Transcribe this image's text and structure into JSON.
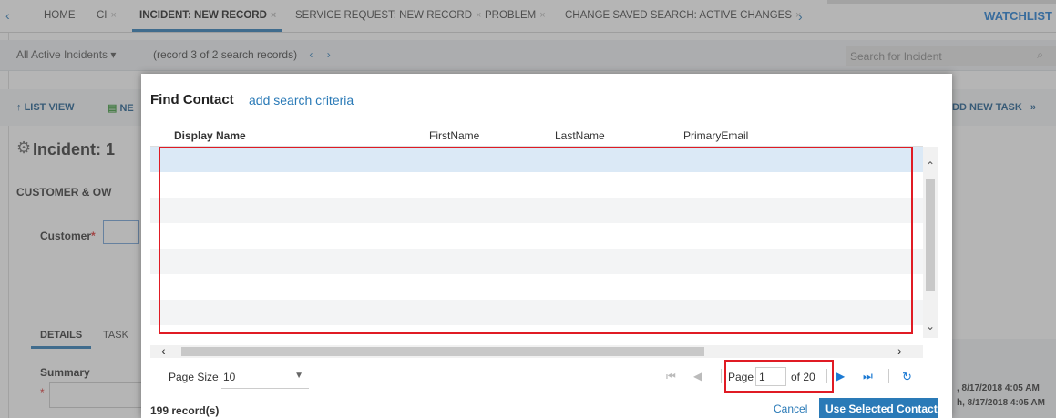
{
  "tabs": {
    "items": [
      {
        "label": "HOME",
        "closable": false
      },
      {
        "label": "CI",
        "closable": true
      },
      {
        "label": "INCIDENT: NEW RECORD",
        "closable": true,
        "active": true
      },
      {
        "label": "SERVICE REQUEST: NEW RECORD",
        "closable": true
      },
      {
        "label": "PROBLEM",
        "closable": true
      },
      {
        "label": "CHANGE SAVED SEARCH: ACTIVE CHANGES",
        "closable": true
      }
    ],
    "close_glyph": "×",
    "watchlist": "WATCHLIST"
  },
  "toolbar": {
    "saved_search": "All Active Incidents",
    "record_info": "(record 3 of 2 search records)",
    "search_placeholder": "Search for Incident"
  },
  "actions": {
    "list_view": "LIST VIEW",
    "new_partial": "NE",
    "add_task_partial": "DD NEW TASK"
  },
  "record": {
    "title_partial": "Incident: 1",
    "section_partial": "CUSTOMER & OW",
    "customer_label": "Customer",
    "required_mark": "*",
    "details_tab": "DETAILS",
    "task_tab": "TASK",
    "summary_label": "Summary",
    "timestamps": [
      ", 8/17/2018 4:05 AM",
      "h, 8/17/2018 4:05 AM"
    ]
  },
  "modal": {
    "title": "Find Contact",
    "add_criteria": "add search criteria",
    "columns": [
      "Display Name",
      "FirstName",
      "LastName",
      "PrimaryEmail"
    ],
    "rows_visible": 7,
    "page_size_label": "Page Size",
    "page_size_value": "10",
    "page_label": "Page",
    "page_value": "1",
    "of_pages": "of 20",
    "records": "199 record(s)",
    "cancel": "Cancel",
    "use_selected": "Use Selected Contact"
  },
  "colors": {
    "accent": "#2a7ab7",
    "highlight_box": "#e01b24",
    "selected_row": "#dbe9f6"
  }
}
